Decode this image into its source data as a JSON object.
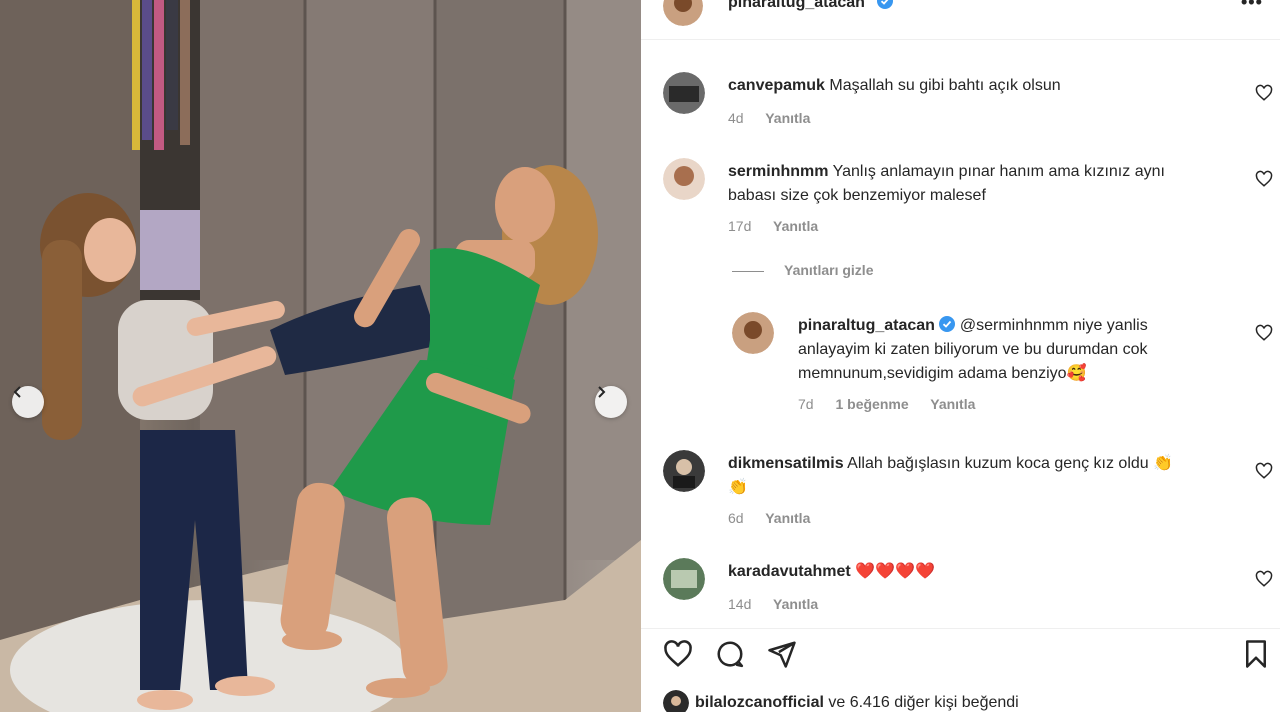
{
  "post": {
    "username": "pinaraltug_atacan",
    "more_icon": "more-options-icon"
  },
  "comments": [
    {
      "user": "canvepamuk",
      "text": "Maşallah su gibi bahtı açık olsun",
      "time": "4d",
      "reply": "Yanıtla"
    },
    {
      "user": "serminhnmm",
      "text_line1": "Yanlış anlamayın pınar hanım ama kızınız aynı",
      "text_line2": "babası size çok benzemiyor malesef",
      "time": "17d",
      "reply": "Yanıtla"
    },
    {
      "user": "pinaraltug_atacan",
      "text_line1": "@serminhnmm niye yanlis",
      "text_line2": "anlayayim ki zaten biliyorum ve bu durumdan cok",
      "text_line3": "memnunum,sevidigim adama benziyo🥰",
      "time": "7d",
      "likes": "1 beğenme",
      "reply": "Yanıtla"
    },
    {
      "user": "dikmensatilmis",
      "text_line1": "Allah bağışlasın kuzum koca genç kız oldu 👏",
      "text_line2": "👏",
      "time": "6d",
      "reply": "Yanıtla"
    },
    {
      "user": "karadavutahmet",
      "text": "❤️❤️❤️❤️",
      "time": "14d",
      "reply": "Yanıtla"
    }
  ],
  "hide_replies": "Yanıtları gizle",
  "liked_by": {
    "user": "bilalozcanofficial",
    "rest": " ve 6.416 diğer kişi beğendi"
  },
  "colors": {
    "verified": "#3897f0",
    "meta": "#8e8e8e",
    "dress": "#1f9a4a"
  }
}
